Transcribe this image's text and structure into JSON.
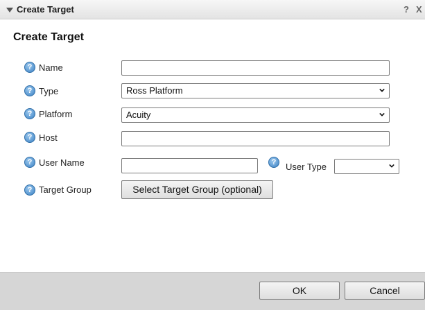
{
  "window": {
    "title": "Create Target",
    "help_label": "?",
    "close_label": "X"
  },
  "heading": "Create Target",
  "help_icon_glyph": "?",
  "fields": {
    "name": {
      "label": "Name",
      "value": ""
    },
    "type": {
      "label": "Type",
      "value": "Ross Platform"
    },
    "platform": {
      "label": "Platform",
      "value": "Acuity"
    },
    "host": {
      "label": "Host",
      "value": ""
    },
    "user_name": {
      "label": "User Name",
      "value": ""
    },
    "user_type": {
      "label": "User Type",
      "value": ""
    },
    "target_group": {
      "label": "Target Group",
      "button_label": "Select Target Group (optional)"
    }
  },
  "footer": {
    "ok_label": "OK",
    "cancel_label": "Cancel"
  },
  "icons": {
    "help": "help-icon",
    "collapse": "triangle-down-icon",
    "dropdown": "chevron-down-icon"
  },
  "colors": {
    "help_icon": "#3b82c4",
    "footer_bg": "#d6d6d6"
  }
}
